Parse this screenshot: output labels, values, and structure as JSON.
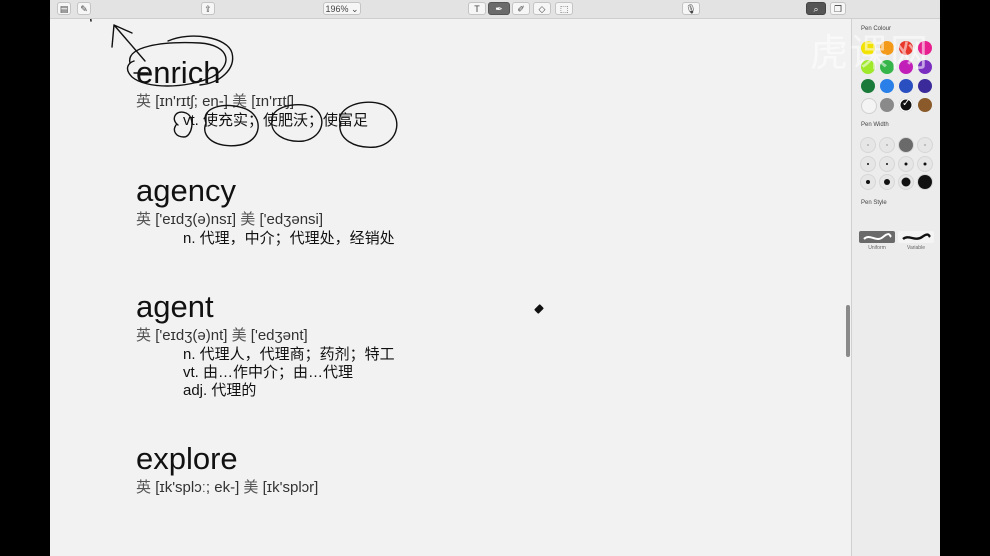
{
  "toolbar": {
    "zoom": "196%"
  },
  "entries": [
    {
      "word": "enrich",
      "uk_label": "英",
      "uk_phon": "[ɪn'rɪtʃ; en-]",
      "us_label": "美",
      "us_phon": "[ɪn'rɪtʃ]",
      "defs": [
        "vt. 使充实；使肥沃；使富足"
      ]
    },
    {
      "word": "agency",
      "uk_label": "英",
      "uk_phon": "['eɪdʒ(ə)nsɪ]",
      "us_label": "美",
      "us_phon": "['edʒənsi]",
      "defs": [
        "n. 代理，中介；代理处，经销处"
      ]
    },
    {
      "word": "agent",
      "uk_label": "英",
      "uk_phon": "['eɪdʒ(ə)nt]",
      "us_label": "美",
      "us_phon": "['edʒənt]",
      "defs": [
        "n. 代理人，代理商；药剂；特工",
        "vt. 由…作中介；由…代理",
        "adj. 代理的"
      ]
    },
    {
      "word": "explore",
      "uk_label": "英",
      "uk_phon": "[ɪk'splɔː; ek-]",
      "us_label": "美",
      "us_phon": "[ɪk'splɔr]",
      "defs": []
    }
  ],
  "panel": {
    "pen_colour_title": "Pen Colour",
    "pen_width_title": "Pen Width",
    "pen_style_title": "Pen Style",
    "style_uniform": "Uniform",
    "style_variable": "Variable",
    "colors": [
      "#f2e200",
      "#f39a1a",
      "#e8362a",
      "#e8208f",
      "#9fe82a",
      "#35b54a",
      "#c21fb8",
      "#7a2fc0",
      "#1a7a3a",
      "#2a7fe8",
      "#2a4fc0",
      "#3a2a9a",
      "#f4f4f4",
      "#8a8a8a",
      "#111111",
      "#8a5a2a"
    ],
    "selected_color_index": 14
  },
  "watermark": "虎课网"
}
